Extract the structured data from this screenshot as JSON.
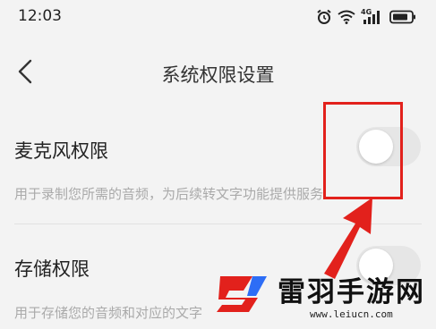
{
  "status_bar": {
    "time": "12:03",
    "signal_label": "4G",
    "icons": [
      "alarm-icon",
      "wifi-icon",
      "cellular-signal-icon",
      "battery-icon"
    ]
  },
  "header": {
    "title": "系统权限设置",
    "back_icon": "chevron-left-icon"
  },
  "settings": [
    {
      "title": "麦克风权限",
      "description": "用于录制您所需的音频，为后续转文字功能提供服务",
      "enabled": false
    },
    {
      "title": "存储权限",
      "description": "用于存储您的音频和对应的文字",
      "enabled": false
    }
  ],
  "annotation": {
    "color": "#e2211c"
  },
  "watermark": {
    "name": "雷羽手游网",
    "url": "www.leiucn.com",
    "brand_color": "#e2211c",
    "accent_color": "#2d6df6"
  }
}
